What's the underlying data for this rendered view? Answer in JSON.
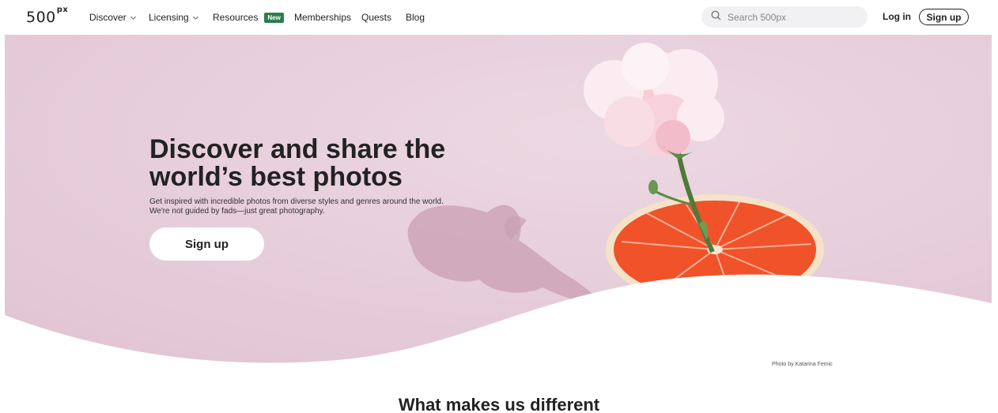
{
  "nav": {
    "logo_text": "500",
    "logo_suffix": "px",
    "items": [
      {
        "label": "Discover",
        "has_dropdown": true
      },
      {
        "label": "Licensing",
        "has_dropdown": true
      },
      {
        "label": "Resources",
        "badge": "New"
      },
      {
        "label": "Memberships"
      },
      {
        "label": "Quests"
      },
      {
        "label": "Blog"
      }
    ],
    "search_placeholder": "Search 500px",
    "login_label": "Log in",
    "signup_label": "Sign up"
  },
  "hero": {
    "title": "Discover and share the world’s best photos",
    "subtitle": "Get inspired with incredible photos from diverse styles and genres around the world. We're not guided by fads—just great photography.",
    "button_label": "Sign up",
    "credit": "Photo by Katarina Femic"
  },
  "section": {
    "title": "What makes us different"
  },
  "colors": {
    "hero_background": "#e7d0dc",
    "badge": "#2c7d4f",
    "grapefruit": "#f0522a"
  },
  "icons": {
    "search": "search-icon",
    "dropdown": "chevron-down-icon"
  }
}
